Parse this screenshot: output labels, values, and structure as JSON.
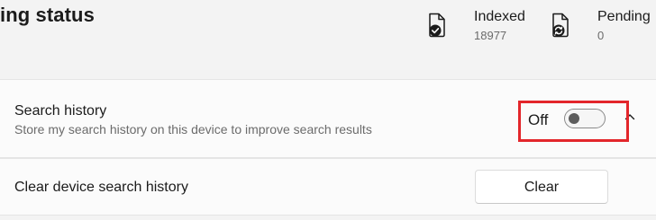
{
  "status_header": {
    "title": "ing status",
    "stats": {
      "indexed": {
        "label": "Indexed",
        "value": "18977",
        "icon": "document-check-icon"
      },
      "pending": {
        "label": "Pending",
        "value": "0",
        "icon": "document-sync-icon"
      }
    }
  },
  "search_history": {
    "title": "Search history",
    "description": "Store my search history on this device to improve search results",
    "toggle": {
      "state_label": "Off",
      "is_on": false
    },
    "expand_icon": "chevron-up-icon"
  },
  "clear_history": {
    "title": "Clear device search history",
    "button_label": "Clear"
  },
  "colors": {
    "highlight": "#e3262b",
    "background": "#f3f3f3",
    "card": "#fbfbfb"
  }
}
